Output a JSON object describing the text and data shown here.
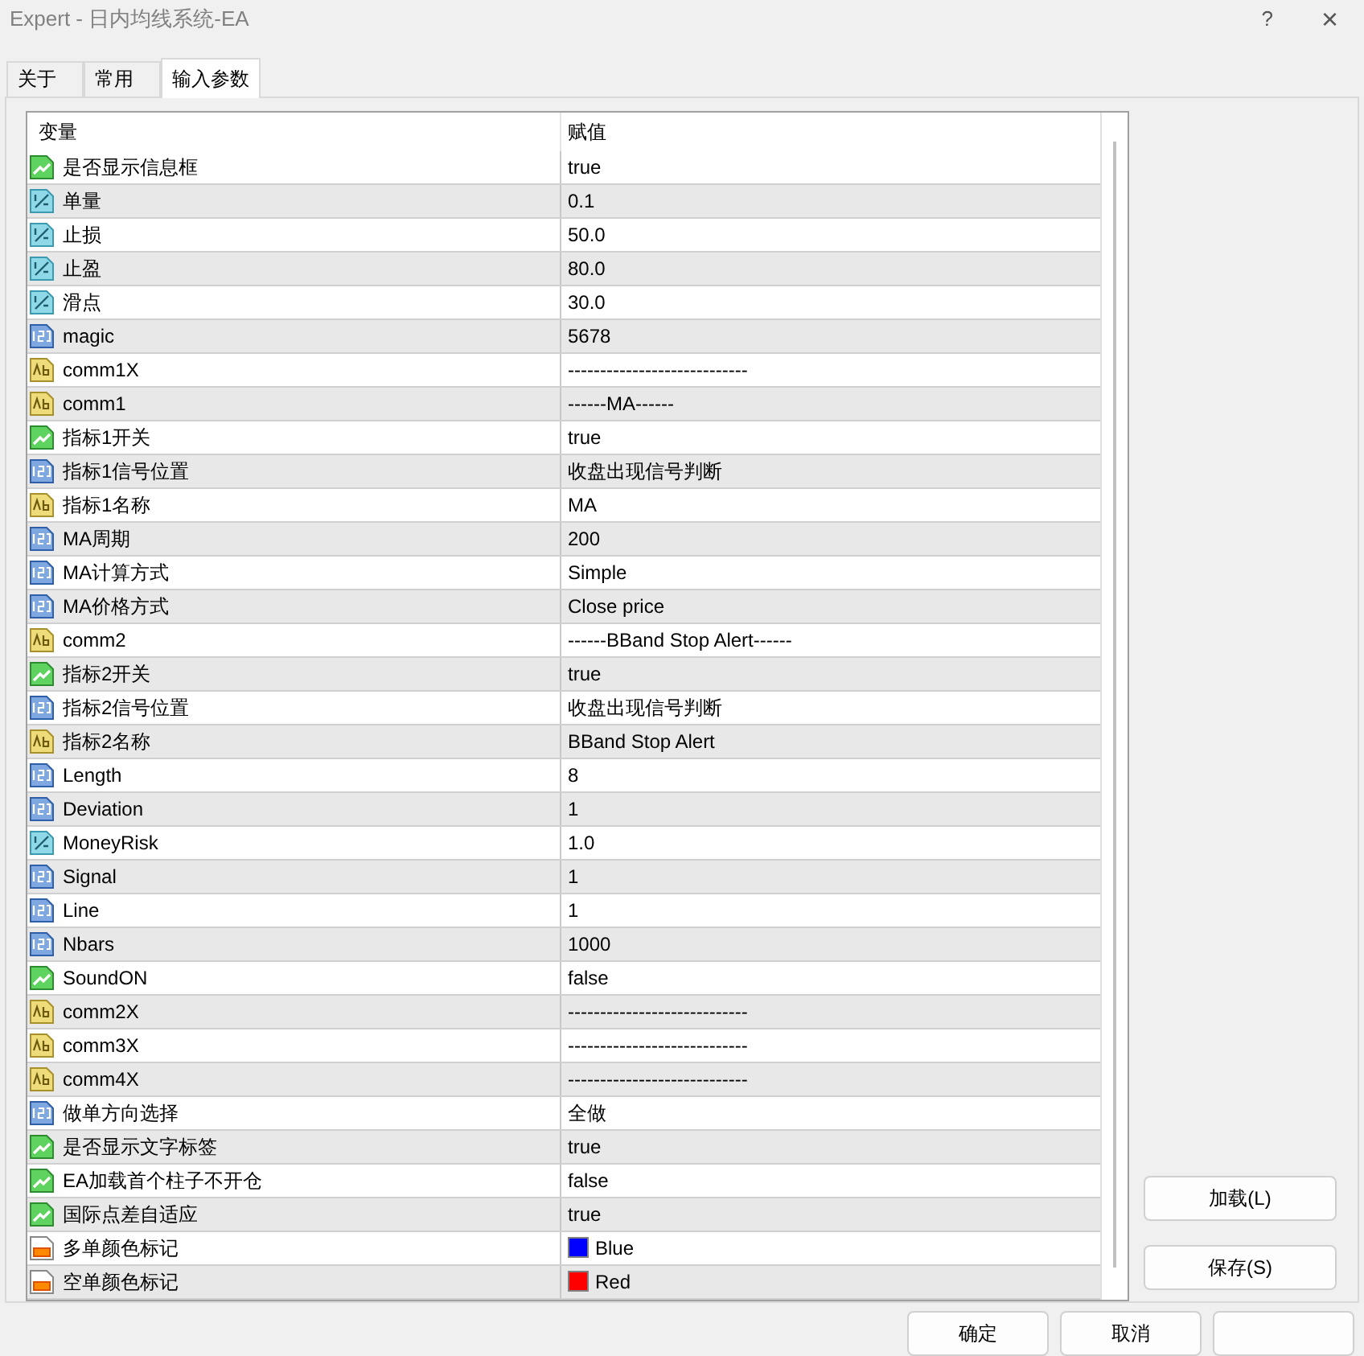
{
  "window": {
    "title": "Expert - 日内均线系统-EA",
    "help": "?",
    "close": "×"
  },
  "tabs": [
    {
      "label": "关于",
      "selected": false
    },
    {
      "label": "常用",
      "selected": false
    },
    {
      "label": "输入参数",
      "selected": true
    }
  ],
  "table": {
    "columns": [
      "变量",
      "赋值"
    ],
    "rows": [
      {
        "kind": "bool",
        "name": "是否显示信息框",
        "value": "true"
      },
      {
        "kind": "double",
        "name": "单量",
        "value": "0.1"
      },
      {
        "kind": "double",
        "name": "止损",
        "value": "50.0"
      },
      {
        "kind": "double",
        "name": "止盈",
        "value": "80.0"
      },
      {
        "kind": "double",
        "name": "滑点",
        "value": "30.0"
      },
      {
        "kind": "int",
        "name": "magic",
        "value": "5678"
      },
      {
        "kind": "string",
        "name": "comm1X",
        "value": "----------------------------"
      },
      {
        "kind": "string",
        "name": "comm1",
        "value": "------MA------"
      },
      {
        "kind": "bool",
        "name": "指标1开关",
        "value": "true"
      },
      {
        "kind": "int",
        "name": "指标1信号位置",
        "value": "收盘出现信号判断"
      },
      {
        "kind": "string",
        "name": "指标1名称",
        "value": "MA"
      },
      {
        "kind": "int",
        "name": "MA周期",
        "value": "200"
      },
      {
        "kind": "int",
        "name": "MA计算方式",
        "value": "Simple"
      },
      {
        "kind": "int",
        "name": "MA价格方式",
        "value": "Close price"
      },
      {
        "kind": "string",
        "name": "comm2",
        "value": "------BBand Stop Alert------"
      },
      {
        "kind": "bool",
        "name": "指标2开关",
        "value": "true"
      },
      {
        "kind": "int",
        "name": "指标2信号位置",
        "value": "收盘出现信号判断"
      },
      {
        "kind": "string",
        "name": "指标2名称",
        "value": "BBand Stop Alert"
      },
      {
        "kind": "int",
        "name": "Length",
        "value": "8"
      },
      {
        "kind": "int",
        "name": "Deviation",
        "value": "1"
      },
      {
        "kind": "double",
        "name": "MoneyRisk",
        "value": "1.0"
      },
      {
        "kind": "int",
        "name": "Signal",
        "value": "1"
      },
      {
        "kind": "int",
        "name": "Line",
        "value": "1"
      },
      {
        "kind": "int",
        "name": "Nbars",
        "value": "1000"
      },
      {
        "kind": "bool",
        "name": "SoundON",
        "value": "false"
      },
      {
        "kind": "string",
        "name": "comm2X",
        "value": "----------------------------"
      },
      {
        "kind": "string",
        "name": "comm3X",
        "value": "----------------------------"
      },
      {
        "kind": "string",
        "name": "comm4X",
        "value": "----------------------------"
      },
      {
        "kind": "int",
        "name": "做单方向选择",
        "value": "全做"
      },
      {
        "kind": "bool",
        "name": "是否显示文字标签",
        "value": "true"
      },
      {
        "kind": "bool",
        "name": "EA加载首个柱子不开仓",
        "value": "false"
      },
      {
        "kind": "bool",
        "name": "国际点差自适应",
        "value": "true"
      },
      {
        "kind": "color",
        "name": "多单颜色标记",
        "value": "Blue",
        "color": "#0000ff"
      },
      {
        "kind": "color",
        "name": "空单颜色标记",
        "value": "Red",
        "color": "#ff0000"
      }
    ]
  },
  "side_buttons": [
    "加载(L)",
    "保存(S)"
  ],
  "bottom_buttons": [
    "确定",
    "取消"
  ]
}
